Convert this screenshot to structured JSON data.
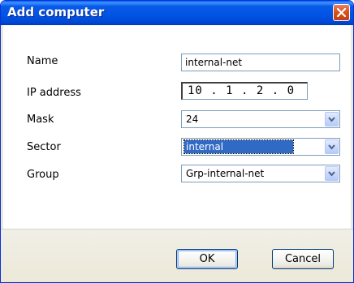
{
  "window": {
    "title": "Add computer"
  },
  "form": {
    "name": {
      "label": "Name",
      "value": "internal-net"
    },
    "ip": {
      "label": "IP address",
      "value": "10 . 1 . 2 . 0"
    },
    "mask": {
      "label": "Mask",
      "value": "24"
    },
    "sector": {
      "label": "Sector",
      "value": "internal"
    },
    "group": {
      "label": "Group",
      "value": "Grp-internal-net"
    }
  },
  "buttons": {
    "ok": "OK",
    "cancel": "Cancel"
  },
  "colors": {
    "titlebar": "#0054e3",
    "close": "#d9531e",
    "selection": "#316ac5",
    "field_border": "#7f9db9"
  },
  "icons": {
    "close": "close-icon",
    "dropdown": "chevron-down-icon"
  }
}
